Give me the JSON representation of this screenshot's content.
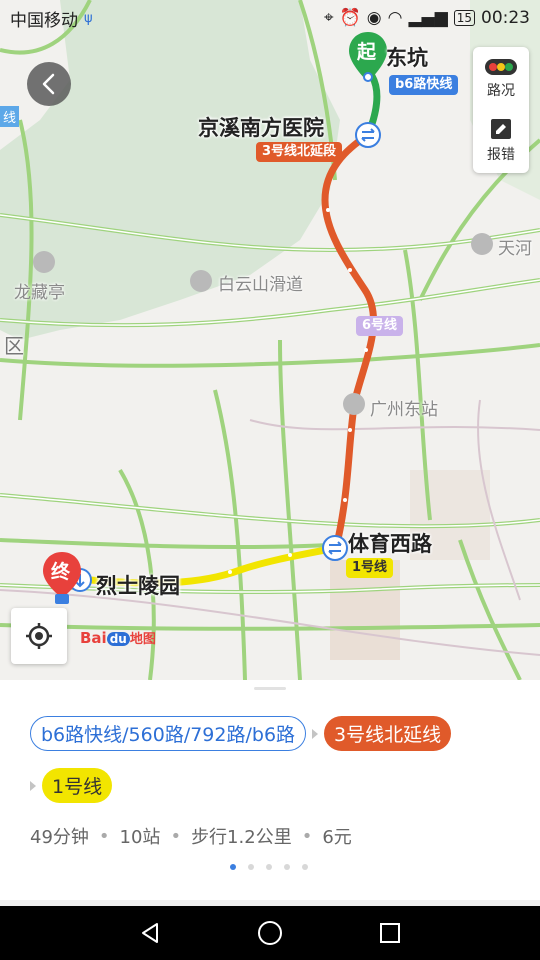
{
  "status_bar": {
    "carrier": "中国移动",
    "battery": "15",
    "time": "00:23"
  },
  "map": {
    "start_badge": "起",
    "end_badge": "终",
    "stations": {
      "start": "东坑",
      "transfer1": "京溪南方医院",
      "transfer2": "体育西路",
      "end": "烈士陵园"
    },
    "line_tags": {
      "b6": "b6路快线",
      "line3": "3号线北延段",
      "line6": "6号线",
      "line1": "1号线"
    },
    "places": {
      "baiyun": "白云山滑道",
      "longcang": "龙藏亭",
      "gz_east": "广州东站",
      "tianhe": "天河",
      "qu": "区",
      "xian": "线"
    },
    "baidu_logo": {
      "bai": "Bai",
      "du": "du",
      "ditu": "地图"
    }
  },
  "side_panel": {
    "traffic_label": "路况",
    "report_label": "报错"
  },
  "route_card": {
    "segments": {
      "bus": "b6路快线/560路/792路/b6路",
      "metro3": "3号线北延线",
      "metro1": "1号线"
    },
    "summary": {
      "duration": "49分钟",
      "stops": "10站",
      "walk": "步行1.2公里",
      "fare": "6元"
    },
    "page_count": 5,
    "active_page": 1
  },
  "colors": {
    "line3": "#e05a2a",
    "line1": "#f2e500",
    "bus_route": "#2ca84e",
    "accent_blue": "#3b7fe0",
    "start_green": "#2ca84e",
    "end_red": "#e8413c"
  }
}
